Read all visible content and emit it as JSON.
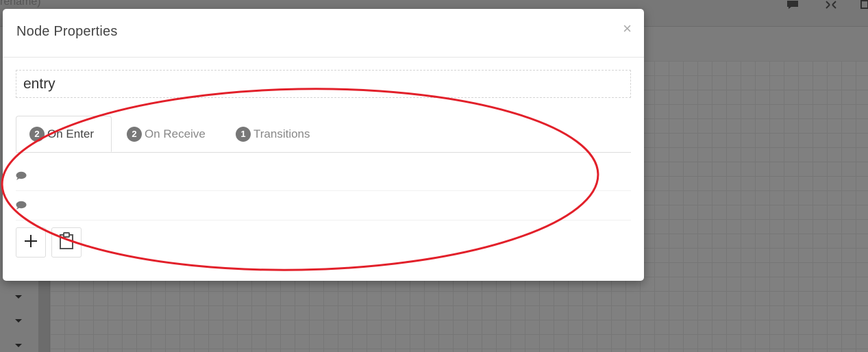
{
  "background": {
    "title_fragment": "rename)"
  },
  "modal": {
    "title": "Node Properties",
    "close_glyph": "×",
    "name_value": "entry",
    "tabs": [
      {
        "count": "2",
        "label": "On Enter",
        "active": true
      },
      {
        "count": "2",
        "label": "On Receive",
        "active": false
      },
      {
        "count": "1",
        "label": "Transitions",
        "active": false
      }
    ],
    "actions": [
      {
        "icon": "speech-bubble-icon"
      },
      {
        "icon": "speech-bubble-icon"
      }
    ],
    "toolbar": {
      "add_icon": "plus-icon",
      "paste_icon": "clipboard-icon"
    }
  },
  "annotation_color": "#e2202a"
}
